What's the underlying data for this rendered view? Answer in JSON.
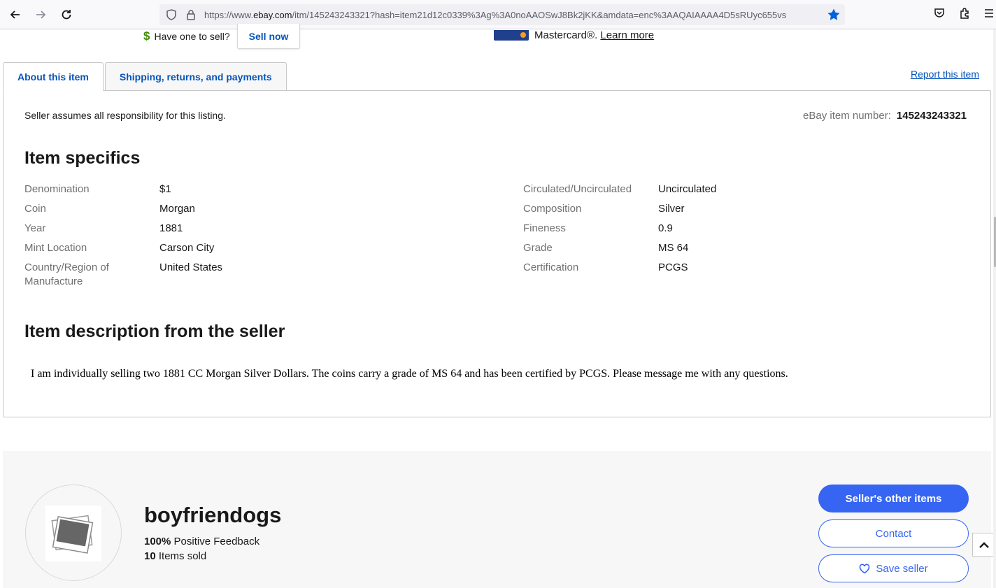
{
  "browser": {
    "url_prefix": "https://www.",
    "url_domain": "ebay.com",
    "url_rest": "/itm/145243243321?hash=item21d12c0339%3Ag%3A0noAAOSwJ8Bk2jKK&amdata=enc%3AAQAIAAAA4D5sRUyc655vs"
  },
  "top_strip": {
    "have_one": "Have one to sell?",
    "sell_now": "Sell now",
    "card_text": "Mastercard®.",
    "learn_more": "Learn more"
  },
  "tabs": [
    {
      "label": "About this item"
    },
    {
      "label": "Shipping, returns, and payments"
    }
  ],
  "report_link": "Report this item",
  "panel": {
    "responsibility": "Seller assumes all responsibility for this listing.",
    "item_number_label": "eBay item number:",
    "item_number": "145243243321",
    "specifics_heading": "Item specifics",
    "specifics_left": [
      {
        "label": "Denomination",
        "value": "$1"
      },
      {
        "label": "Coin",
        "value": "Morgan"
      },
      {
        "label": "Year",
        "value": "1881"
      },
      {
        "label": "Mint Location",
        "value": "Carson City"
      },
      {
        "label": "Country/Region of Manufacture",
        "value": "United States"
      }
    ],
    "specifics_right": [
      {
        "label": "Circulated/Uncirculated",
        "value": "Uncirculated"
      },
      {
        "label": "Composition",
        "value": "Silver"
      },
      {
        "label": "Fineness",
        "value": "0.9"
      },
      {
        "label": "Grade",
        "value": "MS 64"
      },
      {
        "label": "Certification",
        "value": "PCGS"
      }
    ],
    "description_heading": "Item description from the seller",
    "description": "I am individually selling two 1881 CC Morgan Silver Dollars. The coins carry a grade of MS 64 and has been certified by PCGS. Please message me with any questions."
  },
  "seller": {
    "name": "boyfriendogs",
    "feedback_value": "100%",
    "feedback_label": "Positive Feedback",
    "sold_value": "10",
    "sold_label": "Items sold",
    "other_items": "Seller's other items",
    "contact": "Contact",
    "save": "Save seller"
  },
  "colors": {
    "link": "#0654ba",
    "primary_button": "#3665f3"
  }
}
